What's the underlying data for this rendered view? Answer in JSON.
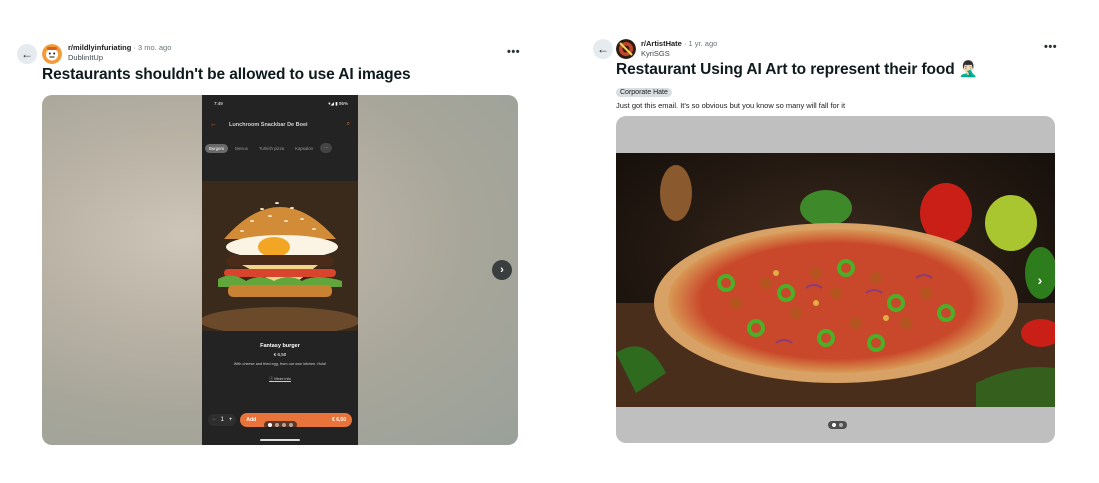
{
  "left_post": {
    "subreddit": "r/mildlyinfuriating",
    "time": "3 mo. ago",
    "username": "DublinItUp",
    "title": "Restaurants shouldn't be allowed to use AI images",
    "more_label": "•••",
    "phone": {
      "status_time": "7:49",
      "status_right": "▾◢ ▮ 95%",
      "page_title": "Lunchroom Snackbar De Boei",
      "tabs": [
        "Burgers",
        "Menus",
        "Turkish pizza",
        "Kapsalon"
      ],
      "product_name": "Fantasy burger",
      "product_price": "€ 6,50",
      "product_description": "With cheese and fried egg, from our own kitchen. Hola!",
      "info_link": "ⓘ Meer info",
      "quantity": "1",
      "add_label": "Add",
      "add_price": "€ 6,50"
    }
  },
  "right_post": {
    "subreddit": "r/ArtistHate",
    "time": "1 yr. ago",
    "username": "KyriSGS",
    "title": "Restaurant Using AI Art to represent their food 🤦🏻‍♂️",
    "flair": "Corporate Hate",
    "body": "Just got this email. It's so obvious but you know so many will fall for it",
    "more_label": "•••"
  },
  "icons": {
    "back": "back-arrow-icon",
    "next": "chevron-right-icon",
    "more": "more-options-icon"
  },
  "colors": {
    "accent_orange": "#e8733b",
    "flair_bg": "#d8dee1",
    "nav_btn": "#282c2e"
  }
}
